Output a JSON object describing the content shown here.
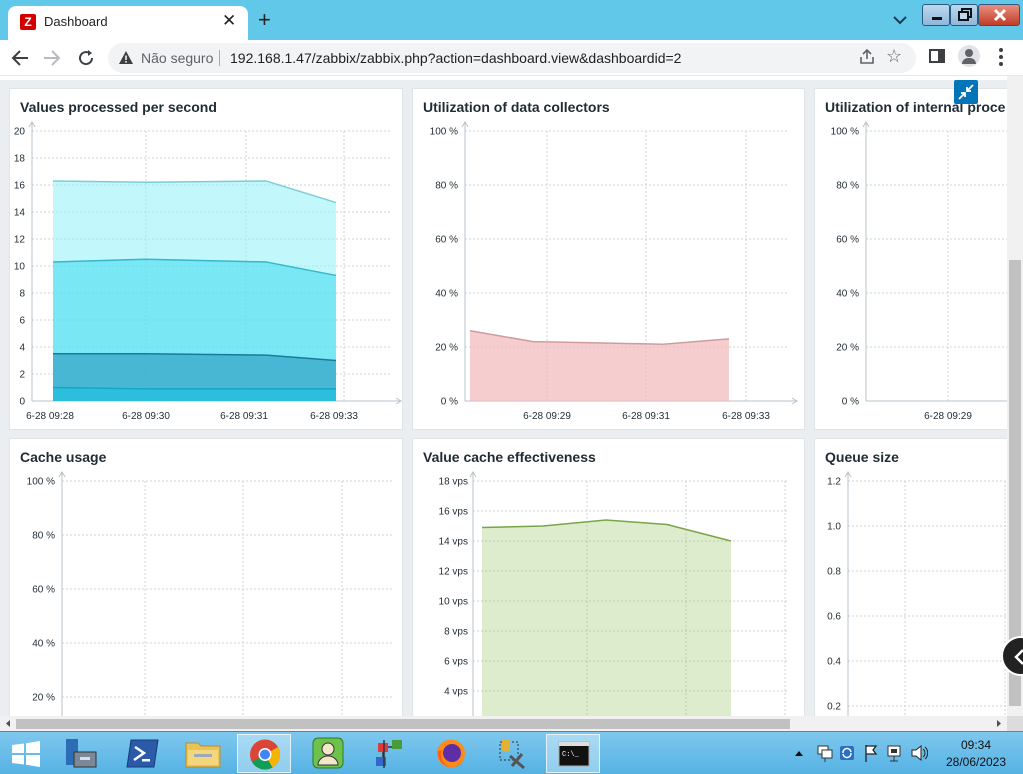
{
  "browser": {
    "tab_title": "Dashboard",
    "tab_favicon_letter": "Z",
    "security_label": "Não seguro",
    "url": "192.168.1.47/zabbix/zabbix.php?action=dashboard.view&dashboardid=2"
  },
  "widgets": {
    "values_processed": {
      "title": "Values processed per second",
      "chart_data": {
        "type": "area",
        "x": [
          "6-28 09:28",
          "6-28 09:30",
          "6-28 09:31",
          "6-28 09:33"
        ],
        "ylim": [
          0,
          20
        ],
        "yticks": [
          "20",
          "18",
          "16",
          "14",
          "12",
          "10",
          "8",
          "6",
          "4",
          "2",
          "0"
        ],
        "series": [
          {
            "values": [
              16.3,
              16.2,
              16.3,
              14.7
            ],
            "color": "#8ff2f8"
          },
          {
            "values": [
              10.3,
              10.5,
              10.3,
              9.3
            ],
            "color": "#3ed8ee"
          },
          {
            "values": [
              3.5,
              3.5,
              3.4,
              3.0
            ],
            "color": "#1f8fb8"
          },
          {
            "values": [
              1.0,
              0.9,
              0.9,
              0.9
            ],
            "color": "#19c4e6"
          }
        ]
      }
    },
    "data_collectors": {
      "title": "Utilization of data collectors",
      "chart_data": {
        "type": "area",
        "x": [
          "6-28 09:29",
          "6-28 09:31",
          "6-28 09:33"
        ],
        "ylim": [
          0,
          100
        ],
        "yticks": [
          "100 %",
          "80 %",
          "60 %",
          "40 %",
          "20 %",
          "0 %"
        ],
        "series": [
          {
            "values": [
              26,
              22,
              21.5,
              21,
              23
            ],
            "color": "#f2b8ba"
          }
        ]
      }
    },
    "internal_processes": {
      "title": "Utilization of internal proce",
      "chart_data": {
        "type": "area",
        "x": [
          "6-28 09:29"
        ],
        "ylim": [
          0,
          100
        ],
        "yticks": [
          "100 %",
          "80 %",
          "60 %",
          "40 %",
          "20 %",
          "0 %"
        ]
      }
    },
    "cache_usage": {
      "title": "Cache usage",
      "chart_data": {
        "type": "area",
        "yticks": [
          "100 %",
          "80 %",
          "60 %",
          "40 %",
          "20 %"
        ]
      }
    },
    "value_cache": {
      "title": "Value cache effectiveness",
      "chart_data": {
        "type": "area",
        "yticks": [
          "18 vps",
          "16 vps",
          "14 vps",
          "12 vps",
          "10 vps",
          "8 vps",
          "6 vps",
          "4 vps"
        ],
        "ylim": [
          2,
          18
        ],
        "series": [
          {
            "values": [
              14.9,
              15.0,
              15.4,
              15.1,
              14.0
            ],
            "color": "#8ec155"
          }
        ]
      }
    },
    "queue_size": {
      "title": "Queue size",
      "chart_data": {
        "type": "line",
        "yticks": [
          "1.2",
          "1.0",
          "0.8",
          "0.6",
          "0.4",
          "0.2"
        ]
      }
    }
  },
  "taskbar": {
    "time": "09:34",
    "date": "28/06/2023"
  }
}
